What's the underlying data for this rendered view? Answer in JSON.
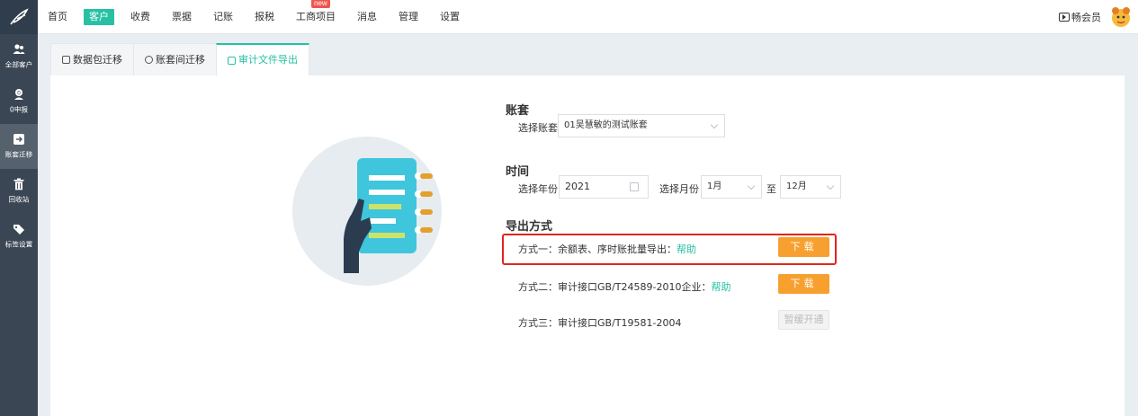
{
  "nav": {
    "items": [
      {
        "label": "首页",
        "active": false
      },
      {
        "label": "客户",
        "active": true
      },
      {
        "label": "收费",
        "active": false
      },
      {
        "label": "票据",
        "active": false
      },
      {
        "label": "记账",
        "active": false
      },
      {
        "label": "报税",
        "active": false
      },
      {
        "label": "工商项目",
        "active": false,
        "badge": "new"
      },
      {
        "label": "消息",
        "active": false
      },
      {
        "label": "管理",
        "active": false
      },
      {
        "label": "设置",
        "active": false
      }
    ],
    "member_label": "畅会员"
  },
  "sidebar": {
    "items": [
      {
        "label": "全部客户",
        "icon": "users-icon",
        "active": false
      },
      {
        "label": "0申报",
        "icon": "zero-report-icon",
        "active": false
      },
      {
        "label": "账套迁移",
        "icon": "migrate-icon",
        "active": true
      },
      {
        "label": "回收站",
        "icon": "trash-icon",
        "active": false
      },
      {
        "label": "标签设置",
        "icon": "tag-icon",
        "active": false
      }
    ]
  },
  "tabs": [
    {
      "label": "数据包迁移",
      "active": false
    },
    {
      "label": "账套间迁移",
      "active": false
    },
    {
      "label": "审计文件导出",
      "active": true
    }
  ],
  "account": {
    "section_title": "账套",
    "select_label": "选择账套：",
    "selected_value": "01吴慧敏的测试账套"
  },
  "time": {
    "section_title": "时间",
    "year_label": "选择年份：",
    "year_value": "2021",
    "month_label": "选择月份：",
    "month_from": "1月",
    "to_label": "至",
    "month_to": "12月"
  },
  "export": {
    "section_title": "导出方式",
    "methods": [
      {
        "text": "方式一：余额表、序时账批量导出：",
        "help": "帮助",
        "button": "下载",
        "enabled": true
      },
      {
        "text": "方式二：审计接口GB/T24589-2010企业：",
        "help": "帮助",
        "button": "下载",
        "enabled": true
      },
      {
        "text": "方式三：审计接口GB/T19581-2004",
        "help": "",
        "button": "暂缓开通",
        "enabled": false
      }
    ]
  },
  "colors": {
    "accent": "#27c0a4",
    "download_button": "#f8a02f",
    "highlight": "#e1251b",
    "sidebar": "#3b4654"
  }
}
